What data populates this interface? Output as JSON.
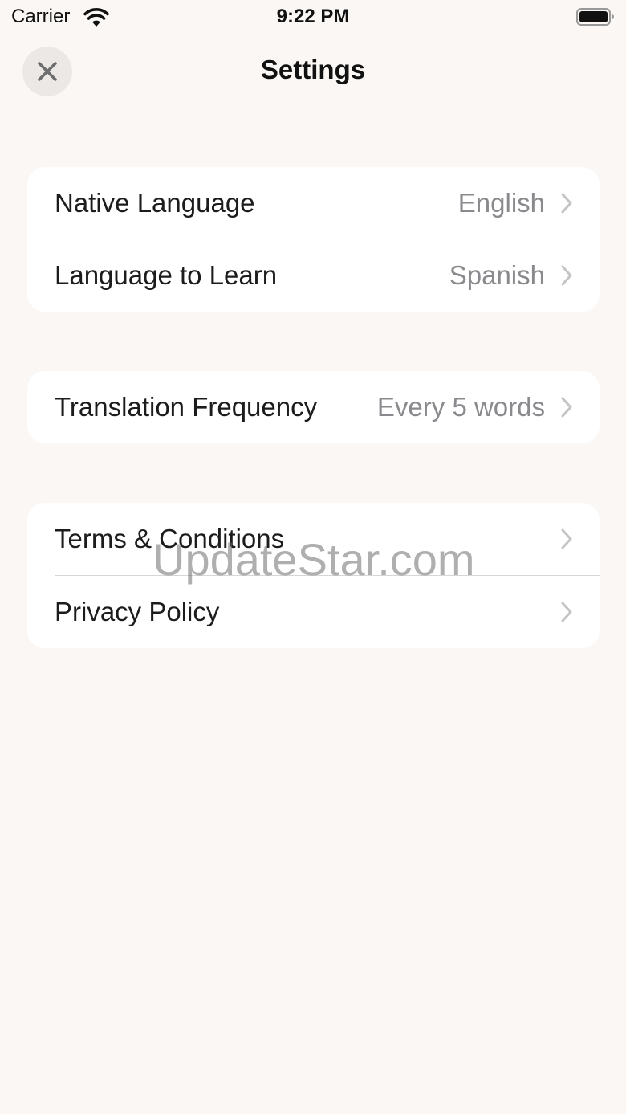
{
  "status_bar": {
    "carrier": "Carrier",
    "time": "9:22 PM"
  },
  "header": {
    "title": "Settings",
    "close_icon": "close-icon"
  },
  "groups": [
    {
      "rows": [
        {
          "label": "Native Language",
          "value": "English"
        },
        {
          "label": "Language to Learn",
          "value": "Spanish"
        }
      ]
    },
    {
      "rows": [
        {
          "label": "Translation Frequency",
          "value": "Every 5 words"
        }
      ]
    },
    {
      "rows": [
        {
          "label": "Terms & Conditions",
          "value": ""
        },
        {
          "label": "Privacy Policy",
          "value": ""
        }
      ]
    }
  ],
  "watermark": "UpdateStar.com",
  "colors": {
    "background": "#fbf7f4",
    "card": "#ffffff",
    "secondary_text": "#8a8a8e",
    "chevron": "#c4c4c7"
  }
}
